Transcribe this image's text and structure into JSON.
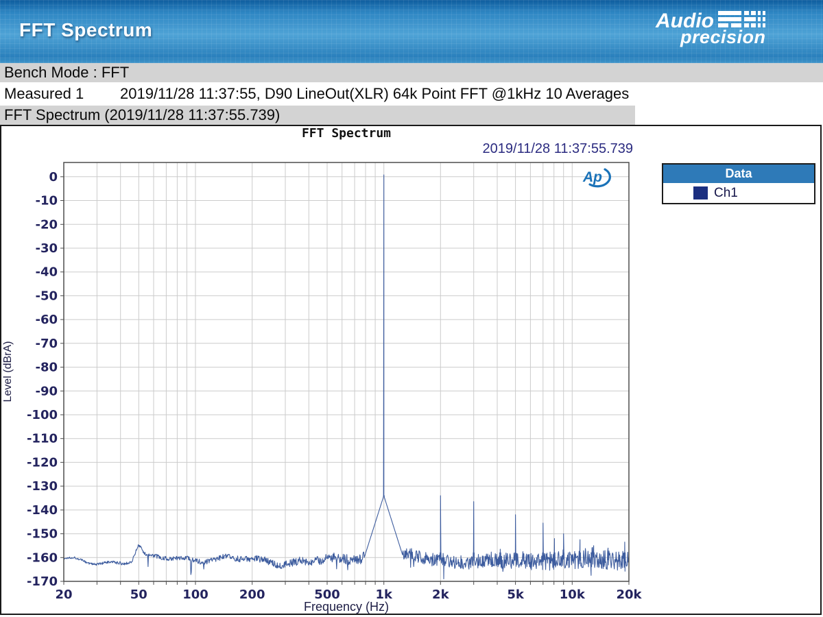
{
  "header": {
    "title": "FFT Spectrum",
    "logo": {
      "line1": "Audio",
      "line2": "precision"
    }
  },
  "info_bars": {
    "bench_mode": "Bench Mode : FFT",
    "measured_label": "Measured 1",
    "measured_info": "2019/11/28 11:37:55, D90 LineOut(XLR) 64k Point FFT @1kHz 10 Averages",
    "graph_caption": "FFT Spectrum (2019/11/28 11:37:55.739)"
  },
  "colors": {
    "accent_blue": "#2e7ab8",
    "trace": "#3d5c9e",
    "legend_swatch": "#1b2f80",
    "grid": "#cbcbcb",
    "plot_border": "#4d4d4d",
    "tick_text": "#23235e",
    "timestamp_text": "#2b2b80",
    "ap_watermark_blue": "#1a72b8"
  },
  "chart_data": {
    "type": "line",
    "title": "FFT Spectrum",
    "timestamp": "2019/11/28 11:37:55.739",
    "xlabel": "Frequency (Hz)",
    "ylabel": "Level (dBrA)",
    "x_scale": "log",
    "x_range_hz": [
      20,
      20000
    ],
    "y_range_db": [
      6,
      -170
    ],
    "grid": true,
    "y_tick_values": [
      0,
      -10,
      -20,
      -30,
      -40,
      -50,
      -60,
      -70,
      -80,
      -90,
      -100,
      -110,
      -120,
      -130,
      -140,
      -150,
      -160,
      -170
    ],
    "y_tick_labels": [
      "0",
      "-10",
      "-20",
      "-30",
      "-40",
      "-50",
      "-60",
      "-70",
      "-80",
      "-90",
      "-100",
      "-110",
      "-120",
      "-130",
      "-140",
      "-150",
      "-160",
      "-170"
    ],
    "x_ticks": [
      {
        "hz": 20,
        "label": "20"
      },
      {
        "hz": 50,
        "label": "50"
      },
      {
        "hz": 100,
        "label": "100"
      },
      {
        "hz": 200,
        "label": "200"
      },
      {
        "hz": 500,
        "label": "500"
      },
      {
        "hz": 1000,
        "label": "1k"
      },
      {
        "hz": 2000,
        "label": "2k"
      },
      {
        "hz": 5000,
        "label": "5k"
      },
      {
        "hz": 10000,
        "label": "10k"
      },
      {
        "hz": 20000,
        "label": "20k"
      }
    ],
    "x_gridlines_hz": [
      20,
      30,
      40,
      50,
      60,
      70,
      80,
      90,
      100,
      200,
      300,
      400,
      500,
      600,
      700,
      800,
      900,
      1000,
      2000,
      3000,
      4000,
      5000,
      6000,
      7000,
      8000,
      9000,
      10000,
      20000
    ],
    "legend": {
      "title": "Data",
      "position": "outside-top-right",
      "entries": [
        {
          "label": "Ch1",
          "color": "#1b2f80"
        }
      ]
    },
    "watermark": "Ap",
    "series": [
      {
        "name": "Ch1",
        "color": "#3d5c9e",
        "fundamental_hz": 1000,
        "fundamental_level_db": 0.8,
        "fundamental_skirt_base_db": -134,
        "noise_floor_db": -161,
        "mains_bump": {
          "hz": 50,
          "rise_db": 5.5
        },
        "harmonics": [
          [
            2000,
            -134
          ],
          [
            3000,
            -136.5
          ],
          [
            4150,
            -156.5
          ],
          [
            5000,
            -142
          ],
          [
            7000,
            -145.5
          ],
          [
            8050,
            -152
          ],
          [
            9000,
            -150
          ],
          [
            11000,
            -152.5
          ],
          [
            13000,
            -155
          ],
          [
            15500,
            -156
          ],
          [
            19000,
            -153.5
          ]
        ],
        "down_spikes": [
          [
            2080,
            -169
          ],
          [
            12600,
            -167.5
          ]
        ]
      }
    ]
  }
}
